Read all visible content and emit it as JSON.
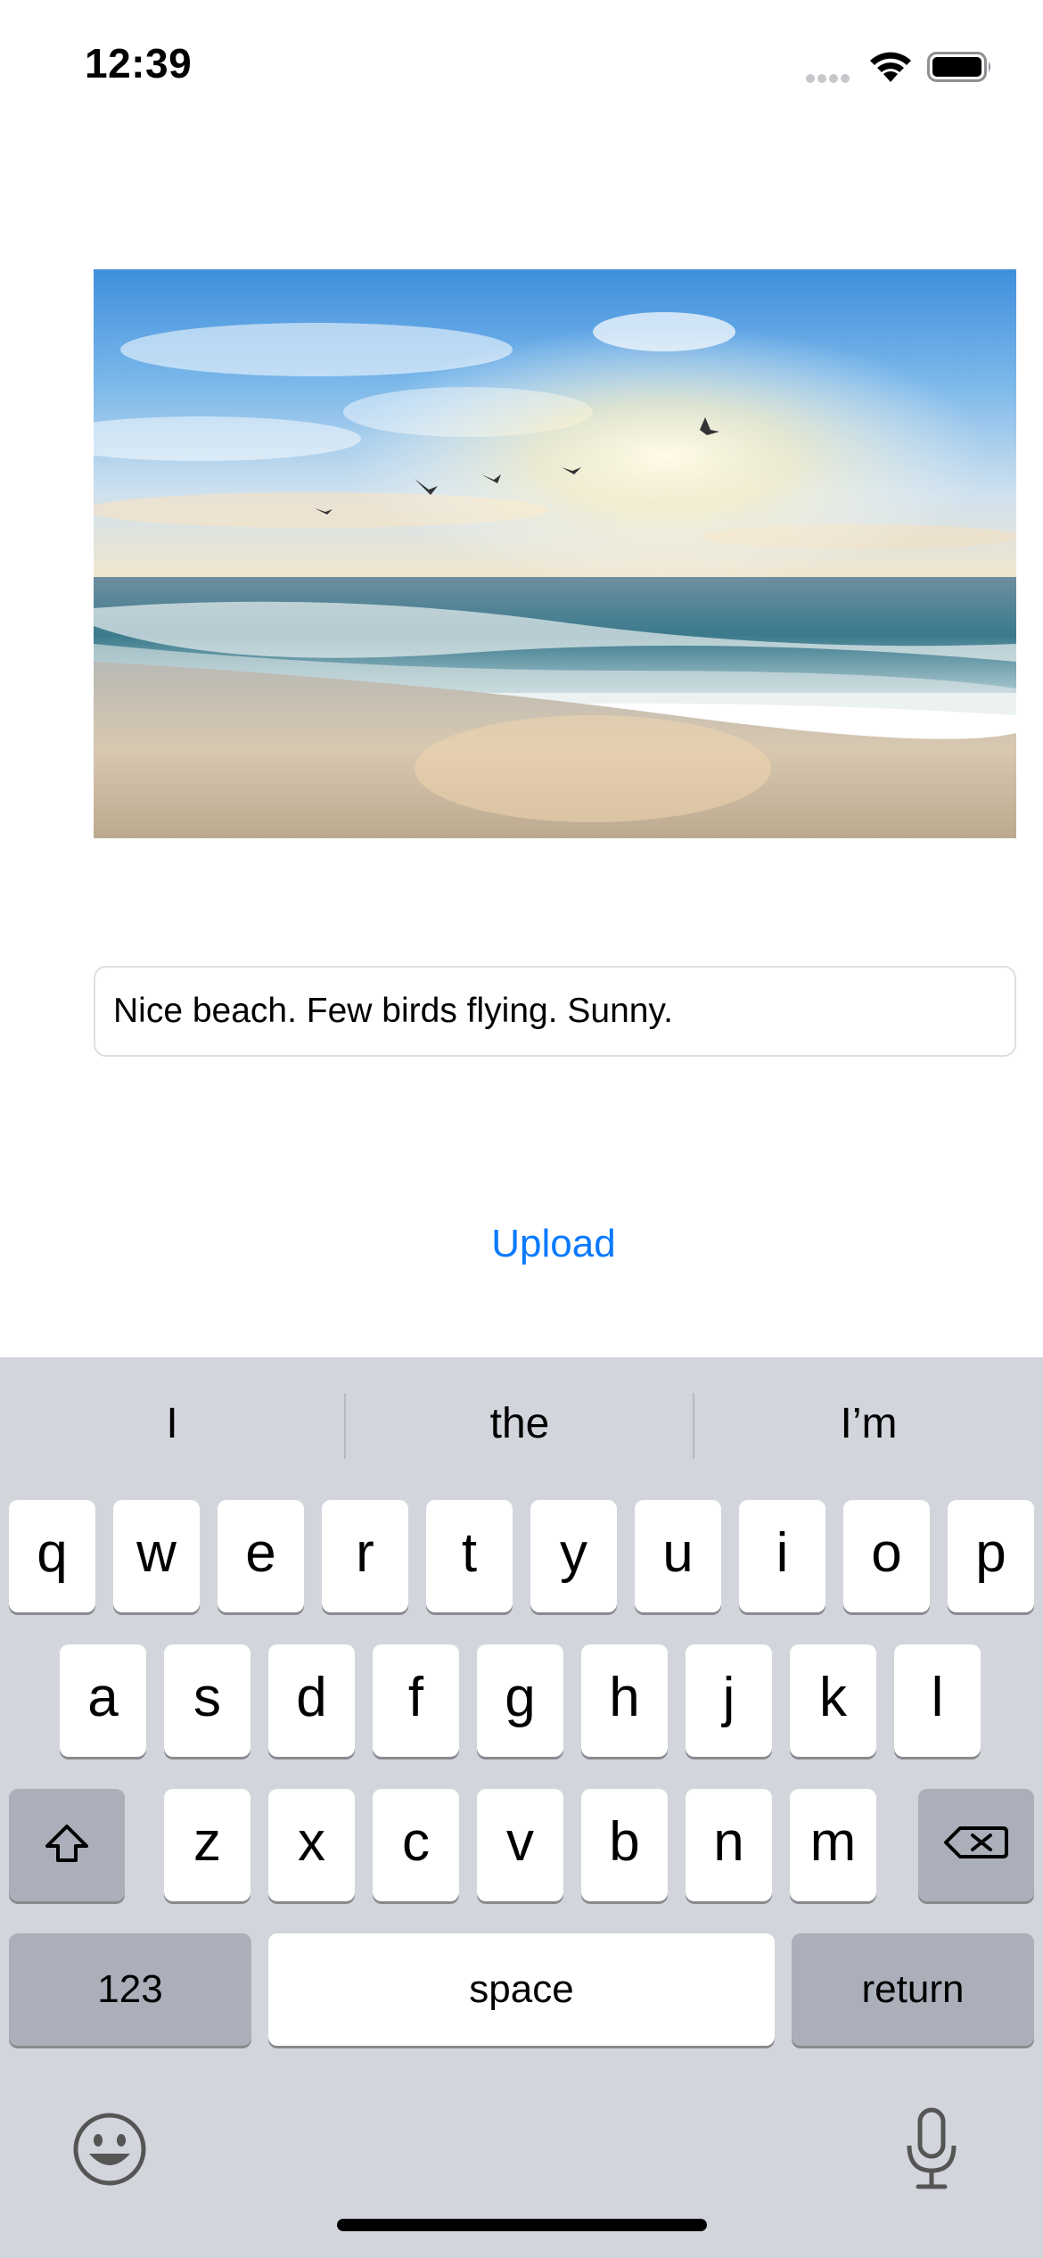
{
  "status_bar": {
    "time": "12:39"
  },
  "photo": {
    "subject": "beach-sunset-photo"
  },
  "caption": {
    "value": "Nice beach. Few birds flying. Sunny."
  },
  "upload": {
    "label": "Upload"
  },
  "keyboard": {
    "predictions": [
      "I",
      "the",
      "I’m"
    ],
    "row1": [
      "q",
      "w",
      "e",
      "r",
      "t",
      "y",
      "u",
      "i",
      "o",
      "p"
    ],
    "row2": [
      "a",
      "s",
      "d",
      "f",
      "g",
      "h",
      "j",
      "k",
      "l"
    ],
    "row3": [
      "z",
      "x",
      "c",
      "v",
      "b",
      "n",
      "m"
    ],
    "numbers_label": "123",
    "space_label": "space",
    "return_label": "return"
  },
  "colors": {
    "accent": "#0a7aff",
    "keyboard_bg": "#d3d5dc",
    "dark_key": "#abafba"
  }
}
